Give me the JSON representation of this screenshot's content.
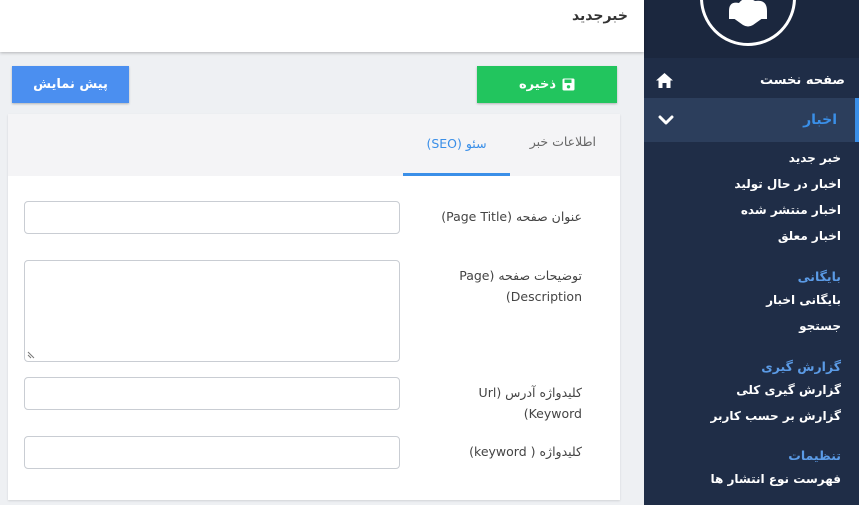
{
  "header": {
    "title": "خبرجدید"
  },
  "toolbar": {
    "save_label": "ذخیره",
    "preview_label": "پیش نمایش"
  },
  "tabs": {
    "info": "اطلاعات خبر",
    "seo": "سئو (SEO)"
  },
  "form": {
    "page_title": {
      "label": "عنوان صفحه (Page Title)",
      "value": "",
      "placeholder": ""
    },
    "page_description": {
      "label": "توضیحات صفحه (Page Description)",
      "value": "",
      "placeholder": ""
    },
    "url_keyword": {
      "label": "کلیدواژه آدرس (Url Keyword)",
      "value": "",
      "placeholder": ""
    },
    "keyword": {
      "label": "کلیدواژه ( keyword)",
      "value": "",
      "placeholder": ""
    }
  },
  "sidebar": {
    "home": "صفحه نخست",
    "news": {
      "label": "اخبار",
      "items": [
        "خبر جدید",
        "اخبار در حال تولید",
        "اخبار منتشر شده",
        "اخبار معلق"
      ]
    },
    "archive": {
      "label": "بایگانی",
      "items": [
        "بایگانی اخبار",
        "جستجو"
      ]
    },
    "reports": {
      "label": "گزارش گیری",
      "items": [
        "گزارش گیری کلی",
        "گزارش بر حسب کاربر"
      ]
    },
    "settings": {
      "label": "تنظیمات",
      "items": [
        "فهرست نوع انتشار ها"
      ]
    }
  },
  "colors": {
    "sidebar_bg": "#1f2d47",
    "accent": "#3a8fe8",
    "save": "#22c55e",
    "preview": "#4b8ff0"
  }
}
